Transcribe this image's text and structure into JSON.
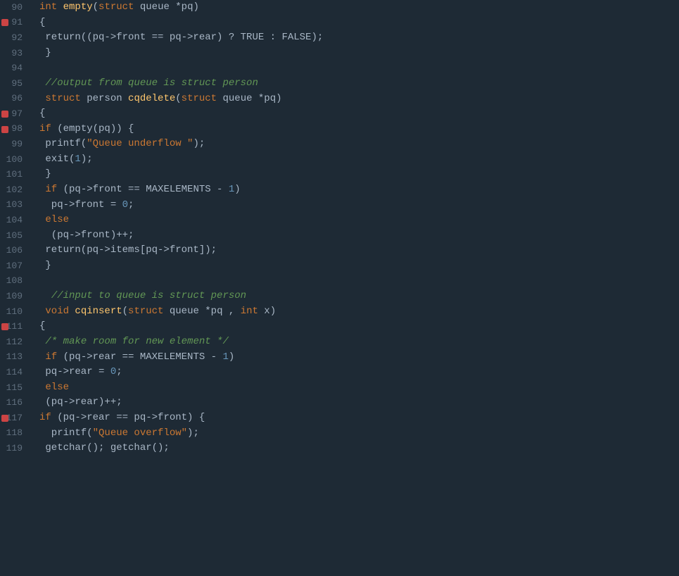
{
  "editor": {
    "background": "#1e2a35",
    "lines": [
      {
        "num": 90,
        "breakpoint": false,
        "tokens": [
          {
            "t": "kw",
            "v": "int"
          },
          {
            "t": "plain",
            "v": " "
          },
          {
            "t": "fn",
            "v": "empty"
          },
          {
            "t": "plain",
            "v": "("
          },
          {
            "t": "kw",
            "v": "struct"
          },
          {
            "t": "plain",
            "v": " queue *pq)"
          }
        ]
      },
      {
        "num": 91,
        "breakpoint": true,
        "tokens": [
          {
            "t": "plain",
            "v": "{"
          }
        ]
      },
      {
        "num": 92,
        "indent": 1,
        "breakpoint": false,
        "tokens": [
          {
            "t": "plain",
            "v": " return((pq->front == pq->rear) ? TRUE : FALSE);"
          }
        ]
      },
      {
        "num": 93,
        "breakpoint": false,
        "tokens": [
          {
            "t": "plain",
            "v": " }"
          }
        ]
      },
      {
        "num": 94,
        "breakpoint": false,
        "tokens": []
      },
      {
        "num": 95,
        "breakpoint": false,
        "tokens": [
          {
            "t": "plain",
            "v": " "
          },
          {
            "t": "cmt",
            "v": "//output from queue is struct person"
          }
        ]
      },
      {
        "num": 96,
        "breakpoint": false,
        "tokens": [
          {
            "t": "plain",
            "v": " "
          },
          {
            "t": "kw",
            "v": "struct"
          },
          {
            "t": "plain",
            "v": " person "
          },
          {
            "t": "fn",
            "v": "cqdelete"
          },
          {
            "t": "plain",
            "v": "("
          },
          {
            "t": "kw",
            "v": "struct"
          },
          {
            "t": "plain",
            "v": " queue *pq)"
          }
        ]
      },
      {
        "num": 97,
        "breakpoint": true,
        "tokens": [
          {
            "t": "plain",
            "v": "{"
          }
        ]
      },
      {
        "num": 98,
        "breakpoint": true,
        "tokens": [
          {
            "t": "kw",
            "v": "if"
          },
          {
            "t": "plain",
            "v": " (empty(pq)) {"
          }
        ]
      },
      {
        "num": 99,
        "breakpoint": false,
        "tokens": [
          {
            "t": "plain",
            "v": " printf("
          },
          {
            "t": "str-orange",
            "v": "\"Queue underflow \""
          },
          {
            "t": "plain",
            "v": ");"
          }
        ]
      },
      {
        "num": 100,
        "breakpoint": false,
        "tokens": [
          {
            "t": "plain",
            "v": " exit("
          },
          {
            "t": "num",
            "v": "1"
          },
          {
            "t": "plain",
            "v": ");"
          }
        ]
      },
      {
        "num": 101,
        "breakpoint": false,
        "tokens": [
          {
            "t": "plain",
            "v": " }"
          }
        ]
      },
      {
        "num": 102,
        "breakpoint": false,
        "tokens": [
          {
            "t": "plain",
            "v": " "
          },
          {
            "t": "kw",
            "v": "if"
          },
          {
            "t": "plain",
            "v": " (pq->front == MAXELEMENTS - "
          },
          {
            "t": "num",
            "v": "1"
          },
          {
            "t": "plain",
            "v": ")"
          }
        ]
      },
      {
        "num": 103,
        "breakpoint": false,
        "tokens": [
          {
            "t": "plain",
            "v": "  pq->front = "
          },
          {
            "t": "num",
            "v": "0"
          },
          {
            "t": "plain",
            "v": ";"
          }
        ]
      },
      {
        "num": 104,
        "breakpoint": false,
        "tokens": [
          {
            "t": "plain",
            "v": " "
          },
          {
            "t": "kw",
            "v": "else"
          }
        ]
      },
      {
        "num": 105,
        "breakpoint": false,
        "tokens": [
          {
            "t": "plain",
            "v": "  (pq->front)++;"
          }
        ]
      },
      {
        "num": 106,
        "breakpoint": false,
        "tokens": [
          {
            "t": "plain",
            "v": " return(pq->items[pq->front]);"
          }
        ]
      },
      {
        "num": 107,
        "breakpoint": false,
        "tokens": [
          {
            "t": "plain",
            "v": " }"
          }
        ]
      },
      {
        "num": 108,
        "breakpoint": false,
        "tokens": []
      },
      {
        "num": 109,
        "breakpoint": false,
        "tokens": [
          {
            "t": "plain",
            "v": "  "
          },
          {
            "t": "cmt",
            "v": "//input to queue is struct person"
          }
        ]
      },
      {
        "num": 110,
        "breakpoint": false,
        "tokens": [
          {
            "t": "plain",
            "v": " "
          },
          {
            "t": "kw",
            "v": "void"
          },
          {
            "t": "plain",
            "v": " "
          },
          {
            "t": "fn",
            "v": "cqinsert"
          },
          {
            "t": "plain",
            "v": "("
          },
          {
            "t": "kw",
            "v": "struct"
          },
          {
            "t": "plain",
            "v": " queue *pq , "
          },
          {
            "t": "kw",
            "v": "int"
          },
          {
            "t": "plain",
            "v": " x)"
          }
        ]
      },
      {
        "num": 111,
        "breakpoint": true,
        "tokens": [
          {
            "t": "plain",
            "v": "{"
          }
        ]
      },
      {
        "num": 112,
        "breakpoint": false,
        "tokens": [
          {
            "t": "plain",
            "v": " "
          },
          {
            "t": "cmt",
            "v": "/* make room for new element */"
          }
        ]
      },
      {
        "num": 113,
        "breakpoint": false,
        "tokens": [
          {
            "t": "plain",
            "v": " "
          },
          {
            "t": "kw",
            "v": "if"
          },
          {
            "t": "plain",
            "v": " (pq->rear == MAXELEMENTS - "
          },
          {
            "t": "num",
            "v": "1"
          },
          {
            "t": "plain",
            "v": ")"
          }
        ]
      },
      {
        "num": 114,
        "breakpoint": false,
        "tokens": [
          {
            "t": "plain",
            "v": " pq->rear = "
          },
          {
            "t": "num",
            "v": "0"
          },
          {
            "t": "plain",
            "v": ";"
          }
        ]
      },
      {
        "num": 115,
        "breakpoint": false,
        "tokens": [
          {
            "t": "plain",
            "v": " "
          },
          {
            "t": "kw",
            "v": "else"
          }
        ]
      },
      {
        "num": 116,
        "breakpoint": false,
        "tokens": [
          {
            "t": "plain",
            "v": " (pq->rear)++;"
          }
        ]
      },
      {
        "num": 117,
        "breakpoint": true,
        "tokens": [
          {
            "t": "kw",
            "v": "if"
          },
          {
            "t": "plain",
            "v": " (pq->rear == pq->front) {"
          }
        ]
      },
      {
        "num": 118,
        "breakpoint": false,
        "tokens": [
          {
            "t": "plain",
            "v": "  printf("
          },
          {
            "t": "str-orange",
            "v": "\"Queue overflow\""
          },
          {
            "t": "plain",
            "v": ");"
          }
        ]
      },
      {
        "num": 119,
        "breakpoint": false,
        "tokens": [
          {
            "t": "plain",
            "v": " getchar(); getchar();"
          }
        ]
      }
    ]
  }
}
